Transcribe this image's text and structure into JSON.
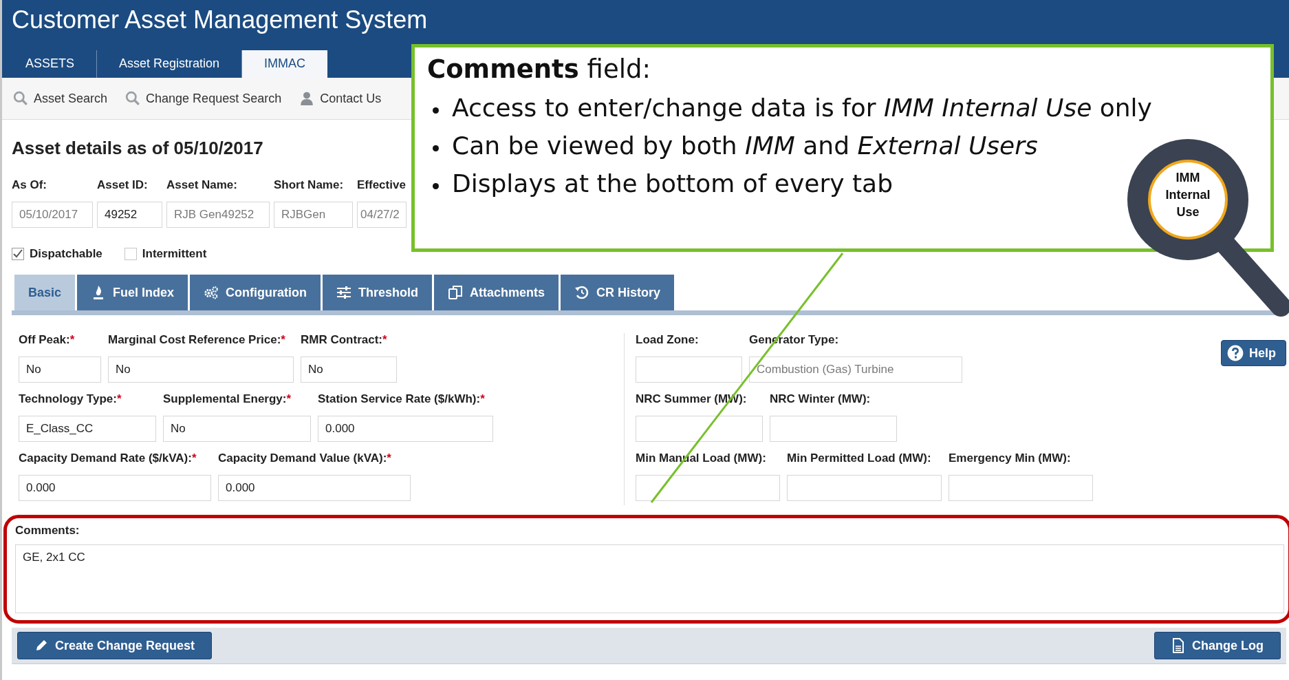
{
  "window": {
    "title": "Customer Asset Management System"
  },
  "nav_tabs": [
    {
      "label": "ASSETS",
      "selected": false
    },
    {
      "label": "Asset Registration",
      "selected": false
    },
    {
      "label": "IMMAC",
      "selected": true
    }
  ],
  "toolbar": [
    {
      "label": "Asset Search",
      "kind": "search"
    },
    {
      "label": "Change Request Search",
      "kind": "search"
    },
    {
      "label": "Contact Us",
      "kind": "person"
    }
  ],
  "heading": "Asset details as of 05/10/2017",
  "asset_fields": [
    {
      "label": "As Of:",
      "value": "05/10/2017",
      "disabled": true
    },
    {
      "label": "Asset ID:",
      "value": "49252",
      "disabled": false
    },
    {
      "label": "Asset Name:",
      "value": "RJB Gen49252",
      "disabled": true
    },
    {
      "label": "Short Name:",
      "value": "RJBGen",
      "disabled": true
    },
    {
      "label": "Effective",
      "value": "04/27/2",
      "disabled": true
    }
  ],
  "checkboxes": [
    {
      "label": "Dispatchable",
      "checked": true
    },
    {
      "label": "Intermittent",
      "checked": false
    }
  ],
  "detail_tabs": [
    {
      "label": "Basic",
      "selected": true,
      "kind": "none"
    },
    {
      "label": "Fuel Index",
      "selected": false,
      "kind": "flame"
    },
    {
      "label": "Configuration",
      "selected": false,
      "kind": "gears"
    },
    {
      "label": "Threshold",
      "selected": false,
      "kind": "sliders"
    },
    {
      "label": "Attachments",
      "selected": false,
      "kind": "documents"
    },
    {
      "label": "CR History",
      "selected": false,
      "kind": "history"
    }
  ],
  "left_rows": [
    [
      {
        "label": "Off Peak:",
        "required_mark": "*",
        "value": "No"
      },
      {
        "label": "Marginal Cost Reference Price:",
        "required_mark": "*",
        "value": "No"
      },
      {
        "label": "RMR Contract:",
        "required_mark": "*",
        "value": "No"
      }
    ],
    [
      {
        "label": "Technology Type:",
        "required_mark": "*",
        "value": "E_Class_CC"
      },
      {
        "label": "Supplemental Energy:",
        "required_mark": "*",
        "value": "No"
      },
      {
        "label": "Station Service Rate ($/kWh):",
        "required_mark": "*",
        "value": "0.000"
      }
    ],
    [
      {
        "label": "Capacity Demand Rate ($/kVA):",
        "required_mark": "*",
        "value": "0.000"
      },
      {
        "label": "Capacity Demand Value (kVA):",
        "required_mark": "*",
        "value": "0.000"
      }
    ]
  ],
  "right_rows": [
    [
      {
        "label": "Load Zone:"
      },
      {
        "label": "Generator Type:",
        "value": "Combustion (Gas) Turbine",
        "disabled": true
      }
    ],
    [
      {
        "label": "NRC Summer (MW):"
      },
      {
        "label": "NRC Winter (MW):"
      }
    ],
    [
      {
        "label": "Min Manual Load (MW):"
      },
      {
        "label": "Min Permitted Load (MW):"
      },
      {
        "label": "Emergency Min (MW):"
      }
    ]
  ],
  "help_button": "Help",
  "comments": {
    "label": "Comments:",
    "value": "GE, 2x1 CC"
  },
  "actions": [
    {
      "label": "Create Change Request",
      "kind": "pencil"
    },
    {
      "label": "Change Log",
      "kind": "document"
    }
  ],
  "callout": {
    "title": "**Comments** field:",
    "bullets": [
      "Access to enter/change data is for *IMM Internal Use* only",
      "Can be viewed by both *IMM* and *External Users*",
      "Displays at the bottom of every tab"
    ],
    "badge": "IMM Internal Use"
  }
}
